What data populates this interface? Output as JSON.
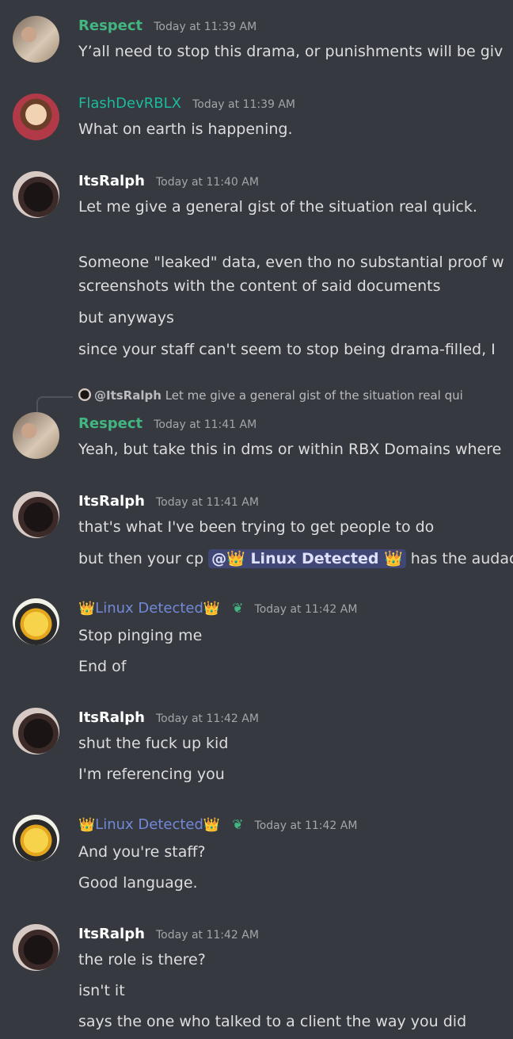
{
  "colors": {
    "background": "#36393f",
    "text": "#dcddde",
    "timestamp": "#a3a6aa",
    "green_role": "#43b581",
    "teal_role": "#1abc9c",
    "blurple": "#7289da",
    "white": "#ffffff",
    "mention_bg": "#414774"
  },
  "messages": [
    {
      "username": "Respect",
      "timestamp": "Today at 11:39 AM",
      "lines": [
        "Y’all need to stop this drama, or punishments will be giv"
      ]
    },
    {
      "username": "FlashDevRBLX",
      "timestamp": "Today at 11:39 AM",
      "lines": [
        "What on earth is happening."
      ]
    },
    {
      "username": "ItsRalph",
      "timestamp": "Today at 11:40 AM",
      "lines": [
        "Let me give a general gist of the situation real quick.",
        "Someone \"leaked\" data, even tho no substantial proof w",
        "screenshots with the content of said documents",
        "but anyways",
        "since your staff can't seem to stop being drama-filled, I"
      ]
    },
    {
      "reply": {
        "mention": "@ItsRalph",
        "preview": "Let me give a general gist of the situation real qui"
      },
      "username": "Respect",
      "timestamp": "Today at 11:41 AM",
      "lines": [
        "Yeah, but take this in dms or within RBX Domains where"
      ]
    },
    {
      "username": "ItsRalph",
      "timestamp": "Today at 11:41 AM",
      "lines": [
        "that's what I've been trying to get people to do"
      ],
      "mention_line": {
        "prefix": "but then your cp",
        "mention": "@👑 Linux Detected 👑",
        "suffix": "has the audac"
      }
    },
    {
      "crown": "👑",
      "username": "Linux Detected",
      "sprout": "❦",
      "timestamp": "Today at 11:42 AM",
      "lines": [
        "Stop pinging me",
        "End of"
      ]
    },
    {
      "username": "ItsRalph",
      "timestamp": "Today at 11:42 AM",
      "lines": [
        "shut the fuck up kid",
        "I'm referencing you"
      ]
    },
    {
      "crown": "👑",
      "username": "Linux Detected",
      "sprout": "❦",
      "timestamp": "Today at 11:42 AM",
      "lines": [
        "And you're staff?",
        "Good language."
      ]
    },
    {
      "username": "ItsRalph",
      "timestamp": "Today at 11:42 AM",
      "lines": [
        "the role is there?",
        "isn't it",
        "says the one who talked to a client the way you did"
      ]
    }
  ]
}
